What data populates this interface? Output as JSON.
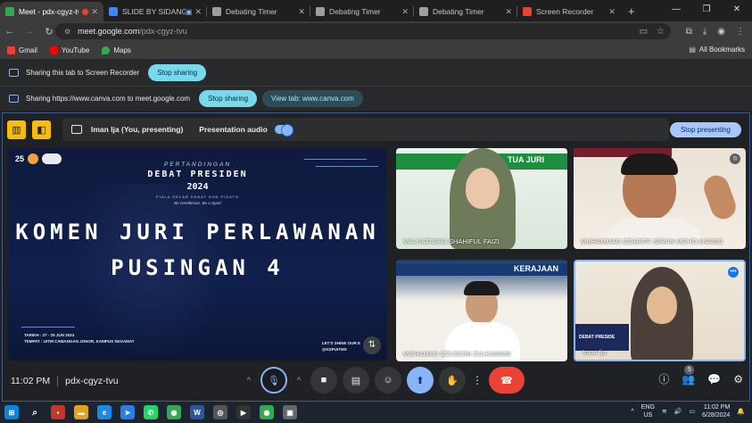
{
  "browser": {
    "tabs": [
      {
        "title": "Meet - pdx-cgyz-tvu",
        "active": true,
        "recording": true,
        "favicon_color": "#34a853"
      },
      {
        "title": "SLIDE BY SIDANG - Pr",
        "active": false,
        "recording": false,
        "favicon_color": "#4285f4"
      },
      {
        "title": "Debating Timer",
        "active": false,
        "favicon_color": "#9aa0a6"
      },
      {
        "title": "Debating Timer",
        "active": false,
        "favicon_color": "#9aa0a6"
      },
      {
        "title": "Debating Timer",
        "active": false,
        "favicon_color": "#9aa0a6"
      },
      {
        "title": "Screen Recorder",
        "active": false,
        "favicon_color": "#ea4335"
      }
    ],
    "new_tab": "+",
    "url_host": "meet.google.com",
    "url_path": "/pdx-cgyz-tvu",
    "bookmarks": [
      {
        "label": "Gmail",
        "color": "#ea4335"
      },
      {
        "label": "YouTube",
        "color": "#ff0000"
      },
      {
        "label": "Maps",
        "color": "#34a853"
      }
    ],
    "all_bookmarks": "All Bookmarks"
  },
  "sharing": {
    "row1_text": "Sharing this tab to Screen Recorder",
    "row1_stop": "Stop sharing",
    "row2_text": "Sharing https://www.canva.com to meet.google.com",
    "row2_stop": "Stop sharing",
    "row2_view": "View tab: www.canva.com"
  },
  "meet": {
    "presenter_label": "Iman Ija (You, presenting)",
    "presentation_audio": "Presentation audio",
    "stop_presenting": "Stop presenting",
    "slide": {
      "line1": "PERTANDINGAN",
      "line2": "DEBAT PRESIDEN",
      "line3": "2024",
      "line4": "PIALA GELAR DEBAT DAN PIDATO",
      "line5": "Be Gentleman, Be a Sport",
      "logo_num": "25",
      "headline1": "KOMEN JURI PERLAWANAN",
      "headline2": "PUSINGAN 4",
      "date_line": "TARIKH : 27 - 29 JUN 2024",
      "venue_line": "TEMPAT : UITM CAWANGAN JOHOR, KAMPUS SEGAMAT",
      "shine_line": "LET'S SHINE OUR E",
      "shine_handle": "@KDPUITMS"
    },
    "participants": [
      {
        "name": "MIA NATASHA SHAHIFUL FAIZI",
        "banner": "TUA JURI"
      },
      {
        "name": "MUHAMMAD DZARIFF IMRAN MOHD ANASID",
        "banner": ""
      },
      {
        "name": "MOHAMAD IZZUDDIN ZULKANAIN",
        "banner": "KERAJAAN"
      },
      {
        "name": "Iman Ija",
        "banner": "DEBAT PRESIDE"
      }
    ],
    "time": "11:02 PM",
    "meeting_code": "pdx-cgyz-tvu",
    "people_count": "5"
  },
  "taskbar": {
    "lang1": "ENG",
    "lang2": "US",
    "clock_time": "11:02 PM",
    "clock_date": "6/28/2024"
  }
}
